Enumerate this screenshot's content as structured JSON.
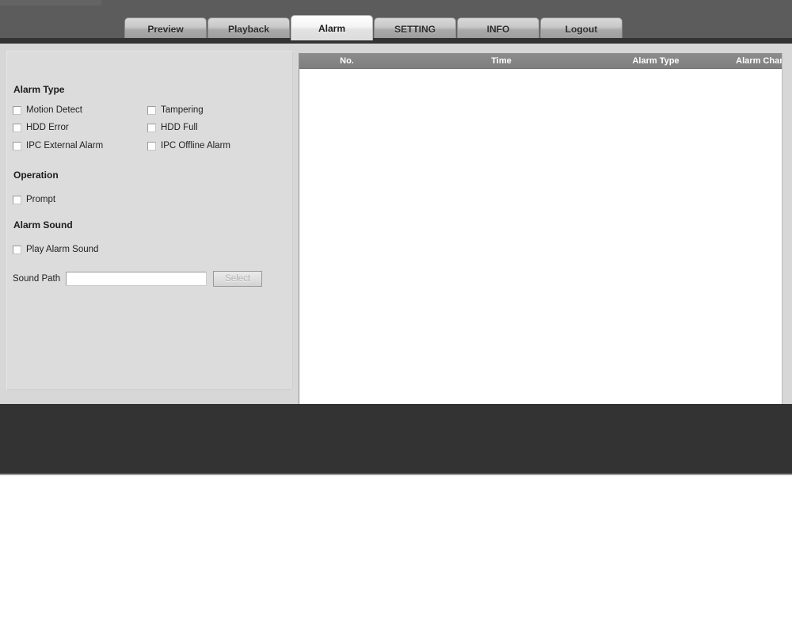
{
  "header": {
    "tabs": [
      {
        "label": "Preview",
        "active": false
      },
      {
        "label": "Playback",
        "active": false
      },
      {
        "label": "Alarm",
        "active": true
      },
      {
        "label": "SETTING",
        "active": false
      },
      {
        "label": "INFO",
        "active": false
      },
      {
        "label": "Logout",
        "active": false
      }
    ]
  },
  "left_panel": {
    "alarm_type": {
      "title": "Alarm Type",
      "items": [
        {
          "label": "Motion Detect",
          "checked": false
        },
        {
          "label": "Tampering",
          "checked": false
        },
        {
          "label": "HDD Error",
          "checked": false
        },
        {
          "label": "HDD Full",
          "checked": false
        },
        {
          "label": "IPC External Alarm",
          "checked": false
        },
        {
          "label": "IPC Offline Alarm",
          "checked": false
        }
      ]
    },
    "operation": {
      "title": "Operation",
      "items": [
        {
          "label": "Prompt",
          "checked": false
        }
      ]
    },
    "alarm_sound": {
      "title": "Alarm Sound",
      "items": [
        {
          "label": "Play Alarm Sound",
          "checked": false
        }
      ],
      "sound_path_label": "Sound Path",
      "sound_path_value": "",
      "sound_path_placeholder": "",
      "select_button": "Select"
    }
  },
  "alarm_list": {
    "columns": [
      "No.",
      "Time",
      "Alarm Type",
      "Alarm Channel"
    ],
    "rows": []
  },
  "colors": {
    "header_bg": "#5c5c5c",
    "body_bg": "#d7d7d7",
    "panel_bg": "#dcdcdc",
    "table_header_bg": "#858585",
    "footer_bg": "#333333",
    "text": "#1f1f1f"
  }
}
